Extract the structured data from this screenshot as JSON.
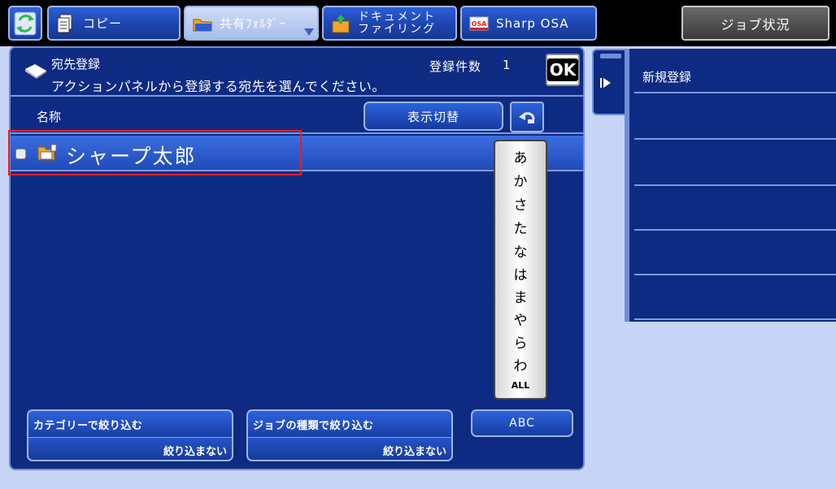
{
  "topbar": {
    "tabs": [
      {
        "label": "コピー",
        "icon": "copy-icon"
      },
      {
        "label": "共有ﾌｫﾙﾀﾞｰ",
        "icon": "shared-folder-icon",
        "active": true
      },
      {
        "label_line1": "ドキュメント",
        "label_line2": "ファイリング",
        "icon": "document-filing-icon"
      },
      {
        "label": "Sharp OSA",
        "icon": "osa-icon"
      }
    ],
    "job_status": "ジョブ状況"
  },
  "header": {
    "title": "宛先登録",
    "message": "アクションパネルから登録する宛先を選んでください。",
    "count_label": "登録件数",
    "count_value": "1",
    "ok": "OK"
  },
  "list": {
    "column_name": "名称",
    "switch_label": "表示切替",
    "rows": [
      {
        "name": "シャープ太郎"
      }
    ]
  },
  "kana_index": [
    "あ",
    "か",
    "さ",
    "た",
    "な",
    "は",
    "ま",
    "や",
    "ら",
    "わ",
    "ALL"
  ],
  "filters": {
    "category_label": "カテゴリーで絞り込む",
    "category_value": "絞り込まない",
    "jobtype_label": "ジョブの種類で絞り込む",
    "jobtype_value": "絞り込まない",
    "abc": "ABC"
  },
  "side_panel": {
    "items": [
      "新規登録",
      "",
      "",
      "",
      "",
      ""
    ]
  },
  "colors": {
    "panel_bg": "#0d2b82",
    "page_bg": "#c6d4f5",
    "highlight": "#e0202a"
  }
}
